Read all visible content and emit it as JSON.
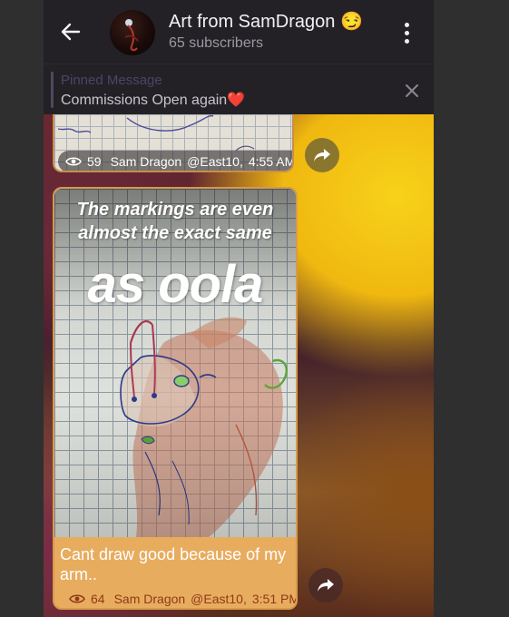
{
  "header": {
    "back_icon": "arrow-left-icon",
    "title": "Art from SamDragon 😏",
    "subscribers": "65 subscribers",
    "menu_icon": "more-vertical-icon"
  },
  "pinned": {
    "label": "Pinned Message",
    "text": "Commissions Open again❤️",
    "close_icon": "close-icon"
  },
  "messages": [
    {
      "views": "59",
      "author": "Sam Dragon",
      "handle": "@East10",
      "time": "4:55 AM",
      "share_icon": "share-icon"
    },
    {
      "caption_line1": "The markings are even",
      "caption_line2": "almost the exact same",
      "caption_big": "as oola",
      "text": "Cant draw good because of my arm..",
      "views": "64",
      "author": "Sam Dragon",
      "handle": "@East10",
      "time": "3:51 PM",
      "share_icon": "share-icon"
    }
  ],
  "colors": {
    "header_bg": "#232126",
    "bubble_accent": "#e8ac5f",
    "wallpaper_yellow": "#f7d21a"
  }
}
